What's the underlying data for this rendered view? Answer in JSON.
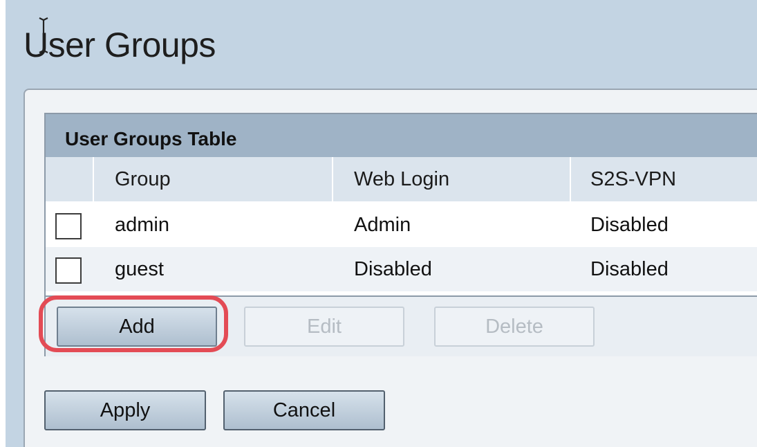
{
  "page": {
    "title": "User Groups"
  },
  "table": {
    "title": "User Groups Table",
    "columns": [
      "Group",
      "Web Login",
      "S2S-VPN"
    ],
    "rows": [
      {
        "checked": false,
        "group": "admin",
        "web_login": "Admin",
        "s2s_vpn": "Disabled"
      },
      {
        "checked": false,
        "group": "guest",
        "web_login": "Disabled",
        "s2s_vpn": "Disabled"
      }
    ],
    "buttons": {
      "add": "Add",
      "edit": "Edit",
      "delete": "Delete"
    }
  },
  "footer": {
    "apply": "Apply",
    "cancel": "Cancel"
  },
  "colors": {
    "background": "#c3d4e3",
    "table_title_bar": "#9fb3c6",
    "header_row": "#dbe4ed",
    "highlight": "#e34b55"
  },
  "icons": {
    "cursor": "text-cursor-icon"
  }
}
